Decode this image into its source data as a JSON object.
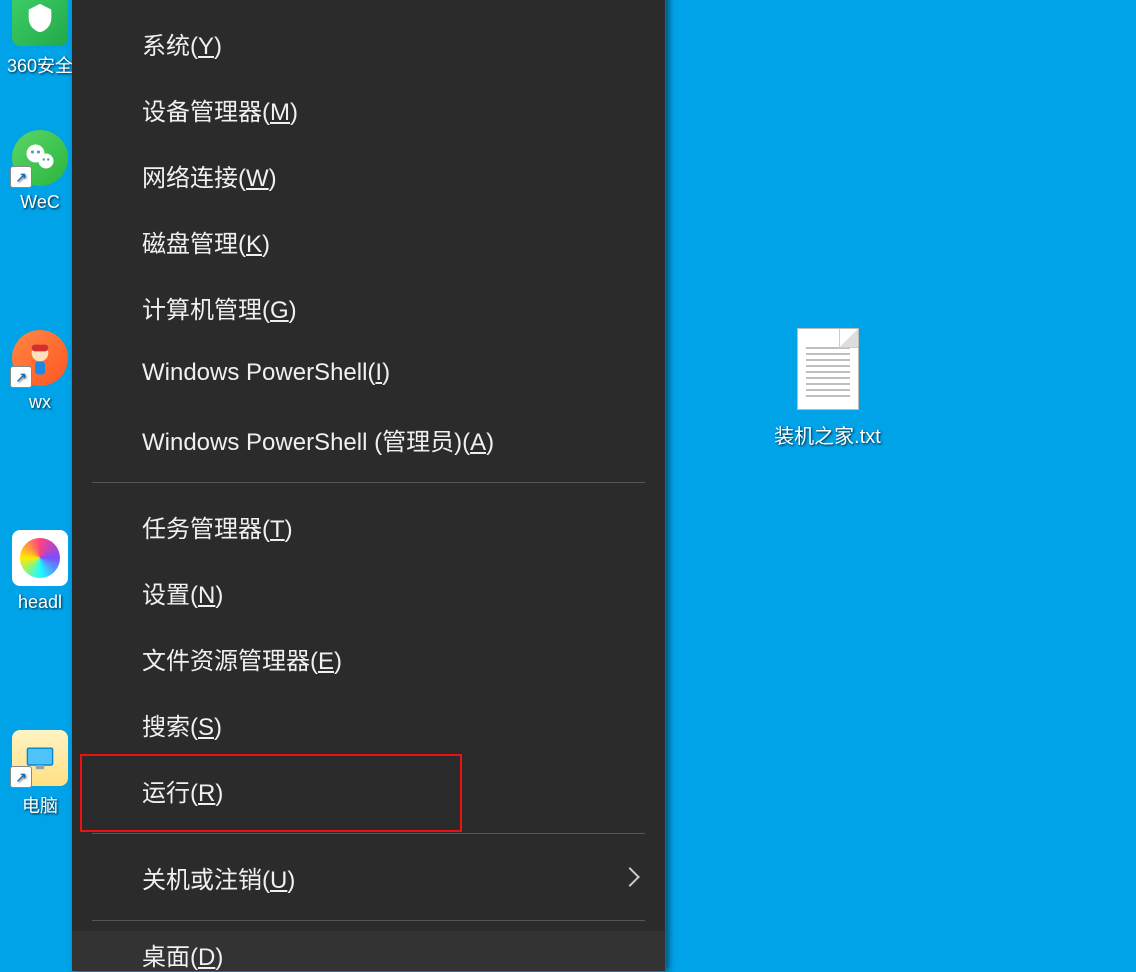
{
  "desktop_icons": {
    "icon360_label": "360安全",
    "wec_label": "WeC",
    "wx_label": "wx",
    "head_label": "headl",
    "pc_label": "电脑"
  },
  "file": {
    "label": "装机之家.txt"
  },
  "menu": {
    "items": [
      {
        "text": "系统",
        "mnemonic": "Y"
      },
      {
        "text": "设备管理器",
        "mnemonic": "M"
      },
      {
        "text": "网络连接",
        "mnemonic": "W"
      },
      {
        "text": "磁盘管理",
        "mnemonic": "K"
      },
      {
        "text": "计算机管理",
        "mnemonic": "G"
      },
      {
        "text": "Windows PowerShell",
        "mnemonic": "I"
      },
      {
        "text": "Windows PowerShell (管理员)",
        "mnemonic": "A"
      }
    ],
    "items2": [
      {
        "text": "任务管理器",
        "mnemonic": "T"
      },
      {
        "text": "设置",
        "mnemonic": "N"
      },
      {
        "text": "文件资源管理器",
        "mnemonic": "E"
      },
      {
        "text": "搜索",
        "mnemonic": "S"
      },
      {
        "text": "运行",
        "mnemonic": "R"
      }
    ],
    "items3": [
      {
        "text": "关机或注销",
        "mnemonic": "U",
        "submenu": true
      }
    ],
    "items4": [
      {
        "text": "桌面",
        "mnemonic": "D"
      }
    ]
  }
}
